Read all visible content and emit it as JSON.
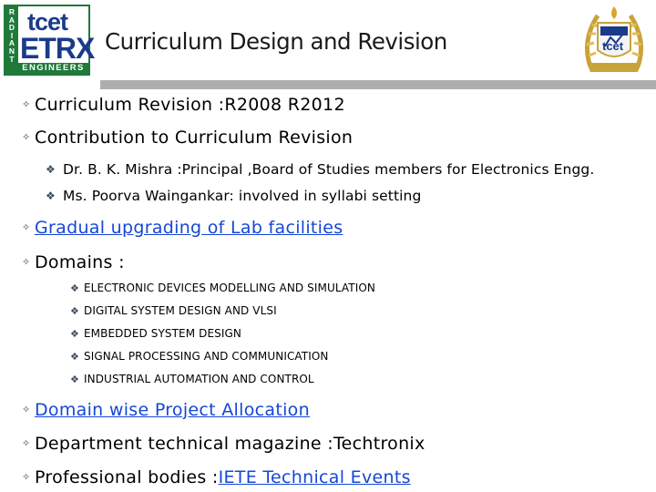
{
  "header": {
    "title": "Curriculum Design and Revision",
    "logo_left": {
      "top": "tcet",
      "middle": "ETRX",
      "bottom": "ENGINEERS",
      "side": "RADIANT"
    },
    "logo_right": {
      "text": "tcet"
    }
  },
  "bullets": {
    "item1": "Curriculum Revision :R2008   R2012",
    "item2": "Contribution to Curriculum Revision",
    "item2_sub": [
      "Dr. B. K. Mishra :Principal ,Board  of Studies members for Electronics Engg.",
      "Ms. Poorva Waingankar: involved in syllabi setting"
    ],
    "item3": "Gradual upgrading of Lab  facilities",
    "item4": "Domains :",
    "domains": [
      " ELECTRONIC DEVICES MODELLING AND SIMULATION",
      "DIGITAL SYSTEM DESIGN AND VLSI",
      "EMBEDDED SYSTEM DESIGN",
      "SIGNAL PROCESSING AND COMMUNICATION",
      "INDUSTRIAL AUTOMATION AND CONTROL"
    ],
    "item5": "Domain wise Project Allocation ",
    "item6": "Department technical magazine :Techtronix",
    "item7_prefix": "Professional bodies :",
    "item7_link": "IETE Technical Events"
  },
  "glyphs": {
    "bullet_l1": "✧",
    "bullet_l2": "❖",
    "bullet_l3": "❖"
  },
  "colors": {
    "logo_green": "#1f7a3a",
    "logo_blue": "#1b3a8a",
    "link": "#1547d6",
    "rule_gray": "#aeaeae"
  }
}
